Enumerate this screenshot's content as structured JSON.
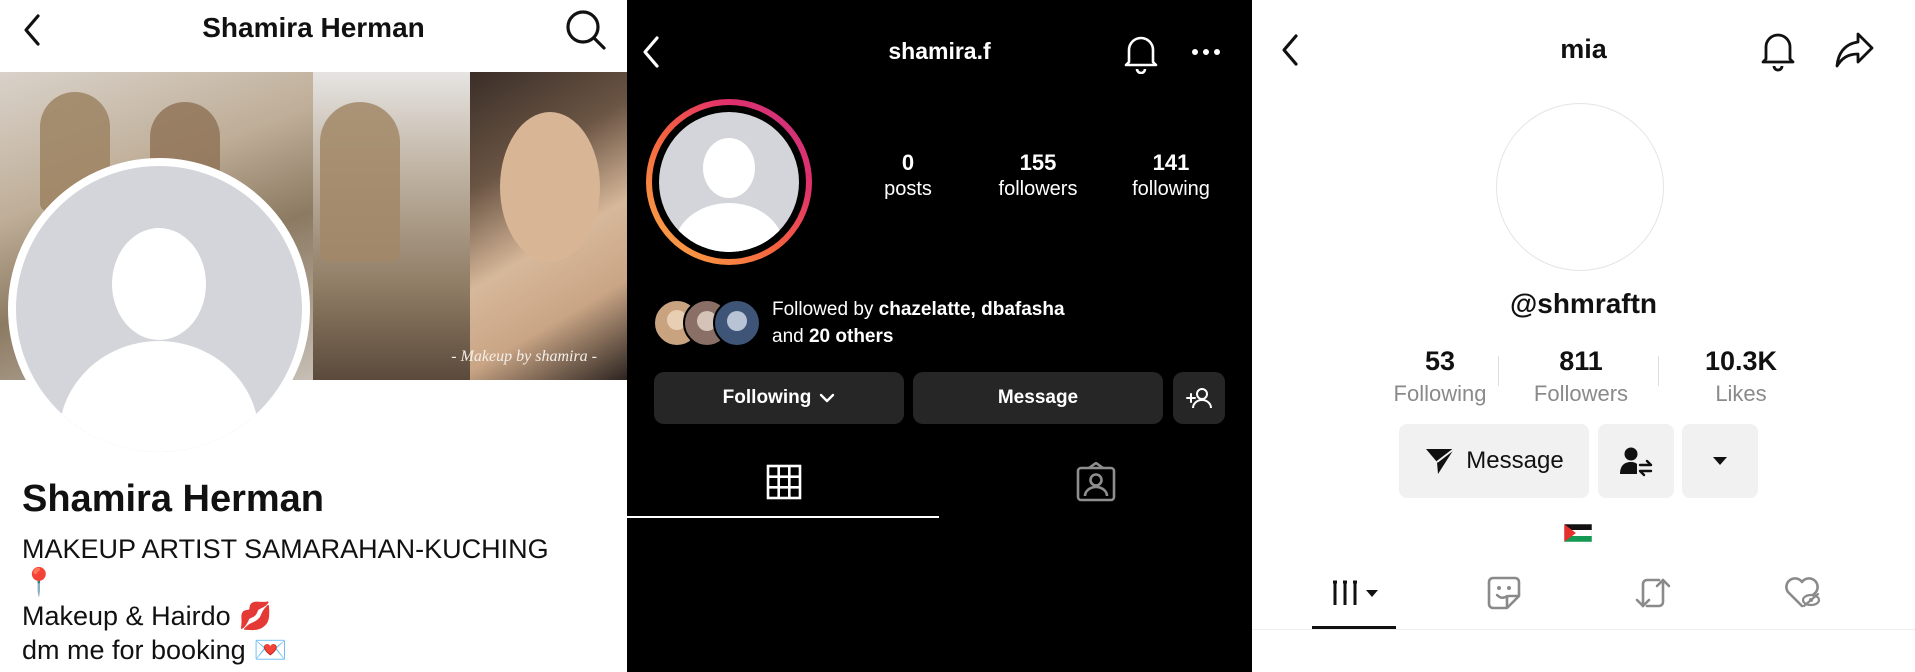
{
  "panel_fb": {
    "title": "Shamira Herman",
    "cover_caption": "- Makeup by shamira -",
    "name": "Shamira Herman",
    "bio_lines": [
      "MAKEUP ARTIST SAMARAHAN-KUCHING",
      "📍",
      "Makeup & Hairdo",
      "dm me for booking"
    ],
    "bio_emojis": [
      "💋",
      "💌"
    ]
  },
  "panel_ig": {
    "username": "shamira.f",
    "stats": [
      {
        "value": "0",
        "label": "posts"
      },
      {
        "value": "155",
        "label": "followers"
      },
      {
        "value": "141",
        "label": "following"
      }
    ],
    "followed_by_prefix": "Followed by ",
    "followed_by_names": "chazelatte, dbafasha",
    "followed_by_and": "and ",
    "followed_by_others": "20 others",
    "buttons": {
      "following": "Following",
      "message": "Message"
    },
    "colors": {
      "background": "#000000",
      "button": "#262626"
    }
  },
  "panel_tt": {
    "title": "mia",
    "handle": "@shmraftn",
    "stats": [
      {
        "value": "53",
        "label": "Following"
      },
      {
        "value": "811",
        "label": "Followers"
      },
      {
        "value": "10.3K",
        "label": "Likes"
      }
    ],
    "buttons": {
      "message": "Message"
    },
    "flag": "palestine-flag"
  }
}
